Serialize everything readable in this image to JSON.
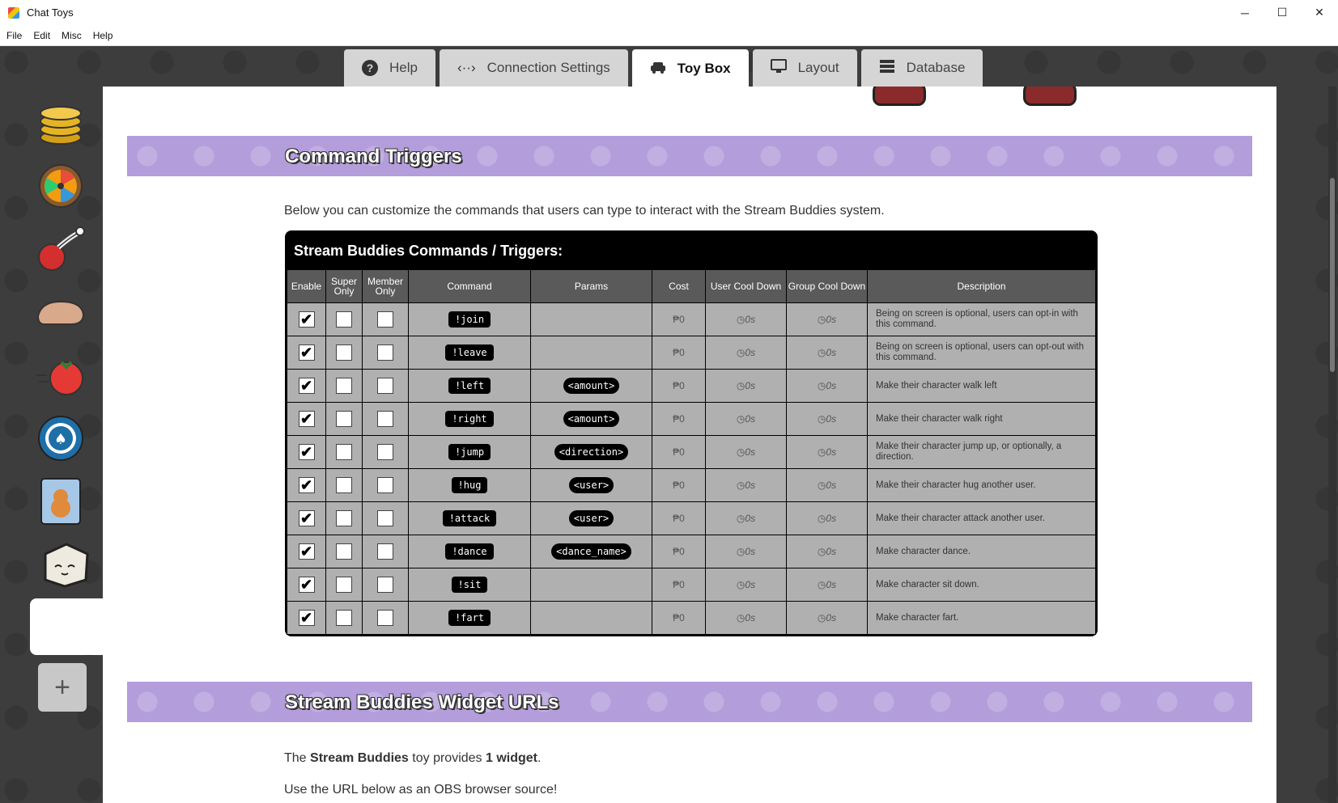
{
  "window": {
    "title": "Chat Toys",
    "minimize": "─",
    "maximize": "☐",
    "close": "✕"
  },
  "menu": [
    "File",
    "Edit",
    "Misc",
    "Help"
  ],
  "tabs": [
    {
      "label": "Help",
      "icon": "question-icon",
      "glyph": "?"
    },
    {
      "label": "Connection Settings",
      "icon": "code-arrows-icon",
      "glyph": "‹··›"
    },
    {
      "label": "Toy Box",
      "icon": "car-icon",
      "glyph": "🚗"
    },
    {
      "label": "Layout",
      "icon": "monitor-icon",
      "glyph": "🖵"
    },
    {
      "label": "Database",
      "icon": "database-icon",
      "glyph": "☰"
    }
  ],
  "active_tab": "Toy Box",
  "sidebar": {
    "items": [
      "coins-icon",
      "prize-wheel-icon",
      "cherry-bomb-icon",
      "hand-icon",
      "tomato-icon",
      "poker-chip-icon",
      "cat-card-icon",
      "stream-buddy-box-icon"
    ],
    "add_label": "+"
  },
  "sections": {
    "command_triggers": {
      "title": "Command Triggers",
      "intro": "Below you can customize the commands that users can type to interact with the Stream Buddies system."
    },
    "widget_urls": {
      "title": "Stream Buddies Widget URLs",
      "line1_pre": "The ",
      "line1_bold1": "Stream Buddies",
      "line1_mid": " toy provides ",
      "line1_bold2": "1 widget",
      "line1_post": ".",
      "line2": "Use the URL below as an OBS browser source!"
    }
  },
  "table": {
    "title": "Stream Buddies Commands / Triggers:",
    "headers": {
      "enable": "Enable",
      "super_only": "Super Only",
      "member_only": "Member Only",
      "command": "Command",
      "params": "Params",
      "cost": "Cost",
      "user_cooldown": "User Cool Down",
      "group_cooldown": "Group Cool Down",
      "description": "Description"
    },
    "cost_value": "₱0",
    "cooldown_value": "0s",
    "rows": [
      {
        "enable": true,
        "super_only": false,
        "member_only": false,
        "command": "!join",
        "params": "",
        "description": "Being on screen is optional, users can opt-in with this command."
      },
      {
        "enable": true,
        "super_only": false,
        "member_only": false,
        "command": "!leave",
        "params": "",
        "description": "Being on screen is optional, users can opt-out with this command."
      },
      {
        "enable": true,
        "super_only": false,
        "member_only": false,
        "command": "!left",
        "params": "<amount>",
        "description": "Make their character walk left"
      },
      {
        "enable": true,
        "super_only": false,
        "member_only": false,
        "command": "!right",
        "params": "<amount>",
        "description": "Make their character walk right"
      },
      {
        "enable": true,
        "super_only": false,
        "member_only": false,
        "command": "!jump",
        "params": "<direction>",
        "description": "Make their character jump up, or optionally, a direction."
      },
      {
        "enable": true,
        "super_only": false,
        "member_only": false,
        "command": "!hug",
        "params": "<user>",
        "description": "Make their character hug another user."
      },
      {
        "enable": true,
        "super_only": false,
        "member_only": false,
        "command": "!attack",
        "params": "<user>",
        "description": "Make their character attack another user."
      },
      {
        "enable": true,
        "super_only": false,
        "member_only": false,
        "command": "!dance",
        "params": "<dance_name>",
        "description": "Make character dance."
      },
      {
        "enable": true,
        "super_only": false,
        "member_only": false,
        "command": "!sit",
        "params": "",
        "description": "Make character sit down."
      },
      {
        "enable": true,
        "super_only": false,
        "member_only": false,
        "command": "!fart",
        "params": "",
        "description": "Make character fart."
      }
    ]
  },
  "colors": {
    "banner": "#b39ddb",
    "table_header": "#5a5a5a",
    "table_cell": "#b0b0b0"
  }
}
